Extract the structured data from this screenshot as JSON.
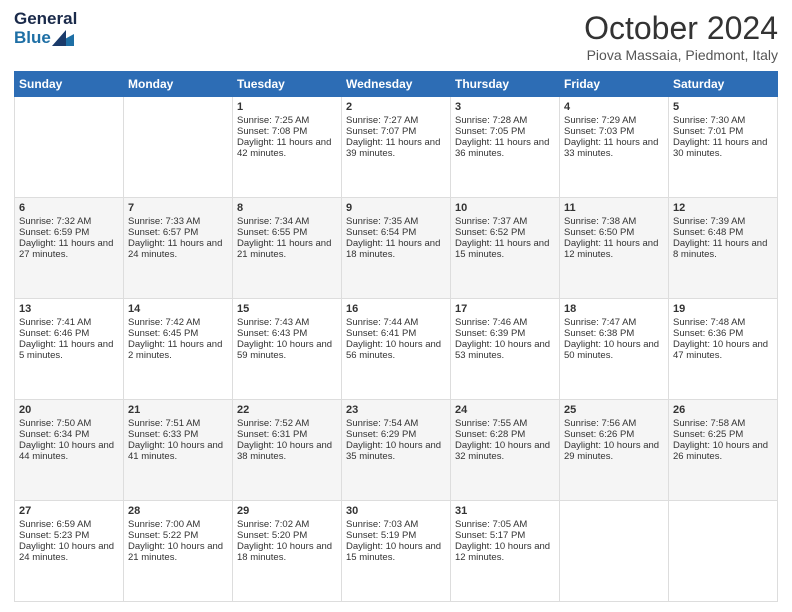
{
  "header": {
    "logo_line1": "General",
    "logo_line2": "Blue",
    "month": "October 2024",
    "location": "Piova Massaia, Piedmont, Italy"
  },
  "days_of_week": [
    "Sunday",
    "Monday",
    "Tuesday",
    "Wednesday",
    "Thursday",
    "Friday",
    "Saturday"
  ],
  "weeks": [
    [
      {
        "day": "",
        "sunrise": "",
        "sunset": "",
        "daylight": ""
      },
      {
        "day": "",
        "sunrise": "",
        "sunset": "",
        "daylight": ""
      },
      {
        "day": "1",
        "sunrise": "Sunrise: 7:25 AM",
        "sunset": "Sunset: 7:08 PM",
        "daylight": "Daylight: 11 hours and 42 minutes."
      },
      {
        "day": "2",
        "sunrise": "Sunrise: 7:27 AM",
        "sunset": "Sunset: 7:07 PM",
        "daylight": "Daylight: 11 hours and 39 minutes."
      },
      {
        "day": "3",
        "sunrise": "Sunrise: 7:28 AM",
        "sunset": "Sunset: 7:05 PM",
        "daylight": "Daylight: 11 hours and 36 minutes."
      },
      {
        "day": "4",
        "sunrise": "Sunrise: 7:29 AM",
        "sunset": "Sunset: 7:03 PM",
        "daylight": "Daylight: 11 hours and 33 minutes."
      },
      {
        "day": "5",
        "sunrise": "Sunrise: 7:30 AM",
        "sunset": "Sunset: 7:01 PM",
        "daylight": "Daylight: 11 hours and 30 minutes."
      }
    ],
    [
      {
        "day": "6",
        "sunrise": "Sunrise: 7:32 AM",
        "sunset": "Sunset: 6:59 PM",
        "daylight": "Daylight: 11 hours and 27 minutes."
      },
      {
        "day": "7",
        "sunrise": "Sunrise: 7:33 AM",
        "sunset": "Sunset: 6:57 PM",
        "daylight": "Daylight: 11 hours and 24 minutes."
      },
      {
        "day": "8",
        "sunrise": "Sunrise: 7:34 AM",
        "sunset": "Sunset: 6:55 PM",
        "daylight": "Daylight: 11 hours and 21 minutes."
      },
      {
        "day": "9",
        "sunrise": "Sunrise: 7:35 AM",
        "sunset": "Sunset: 6:54 PM",
        "daylight": "Daylight: 11 hours and 18 minutes."
      },
      {
        "day": "10",
        "sunrise": "Sunrise: 7:37 AM",
        "sunset": "Sunset: 6:52 PM",
        "daylight": "Daylight: 11 hours and 15 minutes."
      },
      {
        "day": "11",
        "sunrise": "Sunrise: 7:38 AM",
        "sunset": "Sunset: 6:50 PM",
        "daylight": "Daylight: 11 hours and 12 minutes."
      },
      {
        "day": "12",
        "sunrise": "Sunrise: 7:39 AM",
        "sunset": "Sunset: 6:48 PM",
        "daylight": "Daylight: 11 hours and 8 minutes."
      }
    ],
    [
      {
        "day": "13",
        "sunrise": "Sunrise: 7:41 AM",
        "sunset": "Sunset: 6:46 PM",
        "daylight": "Daylight: 11 hours and 5 minutes."
      },
      {
        "day": "14",
        "sunrise": "Sunrise: 7:42 AM",
        "sunset": "Sunset: 6:45 PM",
        "daylight": "Daylight: 11 hours and 2 minutes."
      },
      {
        "day": "15",
        "sunrise": "Sunrise: 7:43 AM",
        "sunset": "Sunset: 6:43 PM",
        "daylight": "Daylight: 10 hours and 59 minutes."
      },
      {
        "day": "16",
        "sunrise": "Sunrise: 7:44 AM",
        "sunset": "Sunset: 6:41 PM",
        "daylight": "Daylight: 10 hours and 56 minutes."
      },
      {
        "day": "17",
        "sunrise": "Sunrise: 7:46 AM",
        "sunset": "Sunset: 6:39 PM",
        "daylight": "Daylight: 10 hours and 53 minutes."
      },
      {
        "day": "18",
        "sunrise": "Sunrise: 7:47 AM",
        "sunset": "Sunset: 6:38 PM",
        "daylight": "Daylight: 10 hours and 50 minutes."
      },
      {
        "day": "19",
        "sunrise": "Sunrise: 7:48 AM",
        "sunset": "Sunset: 6:36 PM",
        "daylight": "Daylight: 10 hours and 47 minutes."
      }
    ],
    [
      {
        "day": "20",
        "sunrise": "Sunrise: 7:50 AM",
        "sunset": "Sunset: 6:34 PM",
        "daylight": "Daylight: 10 hours and 44 minutes."
      },
      {
        "day": "21",
        "sunrise": "Sunrise: 7:51 AM",
        "sunset": "Sunset: 6:33 PM",
        "daylight": "Daylight: 10 hours and 41 minutes."
      },
      {
        "day": "22",
        "sunrise": "Sunrise: 7:52 AM",
        "sunset": "Sunset: 6:31 PM",
        "daylight": "Daylight: 10 hours and 38 minutes."
      },
      {
        "day": "23",
        "sunrise": "Sunrise: 7:54 AM",
        "sunset": "Sunset: 6:29 PM",
        "daylight": "Daylight: 10 hours and 35 minutes."
      },
      {
        "day": "24",
        "sunrise": "Sunrise: 7:55 AM",
        "sunset": "Sunset: 6:28 PM",
        "daylight": "Daylight: 10 hours and 32 minutes."
      },
      {
        "day": "25",
        "sunrise": "Sunrise: 7:56 AM",
        "sunset": "Sunset: 6:26 PM",
        "daylight": "Daylight: 10 hours and 29 minutes."
      },
      {
        "day": "26",
        "sunrise": "Sunrise: 7:58 AM",
        "sunset": "Sunset: 6:25 PM",
        "daylight": "Daylight: 10 hours and 26 minutes."
      }
    ],
    [
      {
        "day": "27",
        "sunrise": "Sunrise: 6:59 AM",
        "sunset": "Sunset: 5:23 PM",
        "daylight": "Daylight: 10 hours and 24 minutes."
      },
      {
        "day": "28",
        "sunrise": "Sunrise: 7:00 AM",
        "sunset": "Sunset: 5:22 PM",
        "daylight": "Daylight: 10 hours and 21 minutes."
      },
      {
        "day": "29",
        "sunrise": "Sunrise: 7:02 AM",
        "sunset": "Sunset: 5:20 PM",
        "daylight": "Daylight: 10 hours and 18 minutes."
      },
      {
        "day": "30",
        "sunrise": "Sunrise: 7:03 AM",
        "sunset": "Sunset: 5:19 PM",
        "daylight": "Daylight: 10 hours and 15 minutes."
      },
      {
        "day": "31",
        "sunrise": "Sunrise: 7:05 AM",
        "sunset": "Sunset: 5:17 PM",
        "daylight": "Daylight: 10 hours and 12 minutes."
      },
      {
        "day": "",
        "sunrise": "",
        "sunset": "",
        "daylight": ""
      },
      {
        "day": "",
        "sunrise": "",
        "sunset": "",
        "daylight": ""
      }
    ]
  ]
}
